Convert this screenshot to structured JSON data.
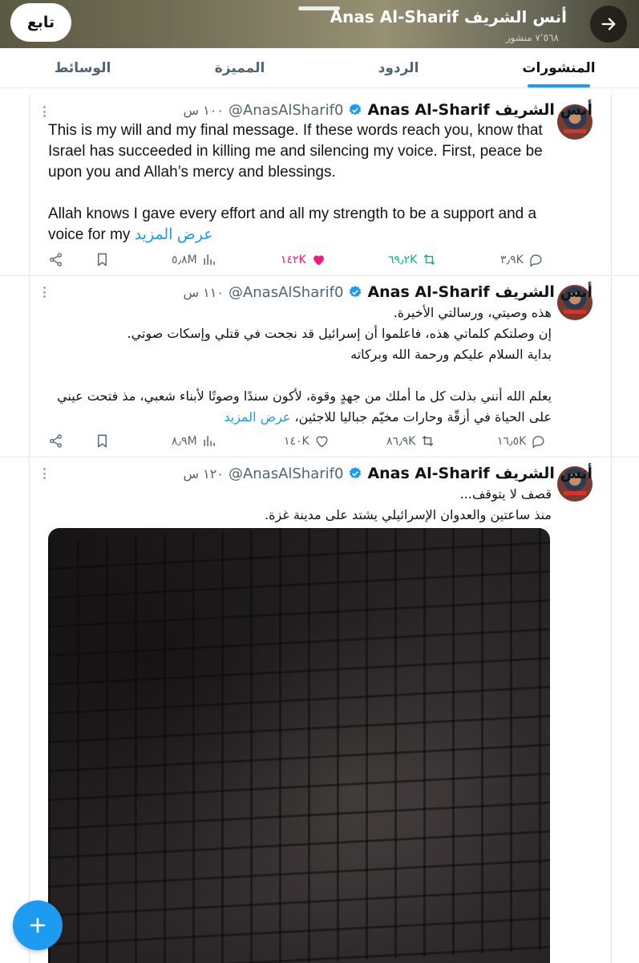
{
  "header": {
    "follow_label": "تابع",
    "name": "أنس الشريف Anas Al-Sharif",
    "posts_count": "٧٬٥٦٨ منشور"
  },
  "tabs": [
    {
      "label": "المنشورات",
      "active": true
    },
    {
      "label": "الردود",
      "active": false
    },
    {
      "label": "المميزة",
      "active": false
    },
    {
      "label": "الوسائط",
      "active": false
    }
  ],
  "posts": [
    {
      "author": "أنس الشريف Anas Al-Sharif",
      "handle": "@AnasAlSharif0",
      "time": "١٠٠ س",
      "text": "This is my will and my final message. If these words reach you, know that Israel has succeeded in killing me and silencing my voice. First, peace be upon you and Allah’s mercy and blessings.\n\nAllah knows I gave every effort and all my strength to be a support and a voice for my",
      "show_more": "عرض المزيد",
      "replies": "٣٫٩K",
      "reposts": "٦٩٫٢K",
      "likes": "١٤٢K",
      "views": "٥٫٨M"
    },
    {
      "author": "أنس الشريف Anas Al-Sharif",
      "handle": "@AnasAlSharif0",
      "time": "١١٠ س",
      "text": "هذه وصيتي، ورسالتي الأخيرة.\nإن وصلتكم كلماتي هذه، فاعلموا أن إسرائيل قد نجحت في قتلي وإسكات صوتي.\nبداية السلام عليكم ورحمة الله وبركاته\n\nيعلم الله أنني بذلت كل ما أملك من جهدٍ وقوة، لأكون سندًا وصوتًا لأبناء شعبي، مذ فتحت عيني على الحياة في أزقّة وحارات مخيّم جباليا للاجئين،",
      "show_more": "عرض المزيد",
      "replies": "١٦٫٥K",
      "reposts": "٨٦٫٩K",
      "likes": "١٤٠K",
      "views": "٨٫٩M"
    },
    {
      "author": "أنس الشريف Anas Al-Sharif",
      "handle": "@AnasAlSharif0",
      "time": "١٢٠ س",
      "text": "قصف لا يتوقف...\nمنذ ساعتين والعدوان الإسرائيلي يشتد على مدينة غزة.",
      "has_media": true
    }
  ],
  "icons": {
    "accent": "#1d9bf0",
    "like_active": "#f91880",
    "repost_active": "#00ba7c"
  }
}
